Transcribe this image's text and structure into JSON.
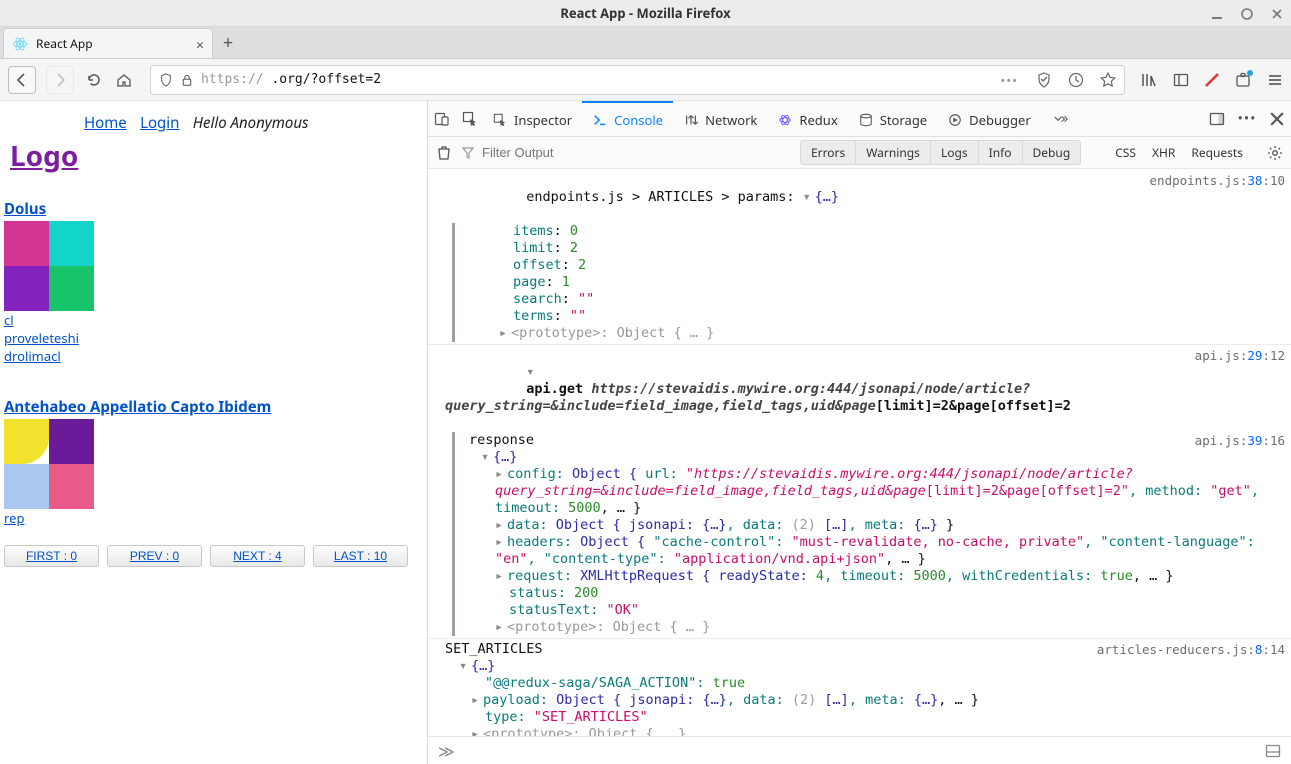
{
  "window": {
    "title": "React App - Mozilla Firefox"
  },
  "tab": {
    "label": "React App"
  },
  "url": {
    "scheme": "https",
    "host_visible": "://",
    "host_blur": "                     ",
    "path": ".org/?offset=2"
  },
  "nav": {
    "home": "Home",
    "login": "Login",
    "greeting": "Hello Anonymous"
  },
  "brand": {
    "logo": "Logo"
  },
  "articles": [
    {
      "title": "Dolus",
      "colors": [
        "#d23494",
        "#12d4c9",
        "#8323bd",
        "#18c56a"
      ],
      "tags": [
        "cl",
        "proveleteshi",
        "drolimacl"
      ]
    },
    {
      "title": "Antehabeo Appellatio Capto Ibidem",
      "colors": [
        "#f2e22e",
        "#6a1b9a",
        "#aac7ef",
        "#e85a87"
      ],
      "tags": [
        "rep"
      ]
    }
  ],
  "pager": {
    "first": "FIRST : 0",
    "prev": "PREV : 0",
    "next": "NEXT : 4",
    "last": "LAST : 10"
  },
  "devtools": {
    "tabs": [
      "Inspector",
      "Console",
      "Network",
      "Redux",
      "Storage",
      "Debugger"
    ],
    "active_tab": "Console",
    "filter_placeholder": "Filter Output",
    "levels": [
      "Errors",
      "Warnings",
      "Logs",
      "Info",
      "Debug"
    ],
    "cats": [
      "CSS",
      "XHR",
      "Requests"
    ],
    "sources": {
      "endpoints": "endpoints.js:38:10",
      "api_get": "api.js:29:12",
      "api_resp": "api.js:39:16",
      "reducers": "articles-reducers.js:8:14"
    }
  },
  "console": {
    "line1_prefix": "endpoints.js > ARTICLES > params: ",
    "params": {
      "items": "0",
      "limit": "2",
      "offset": "2",
      "page": "1",
      "search": "\"\"",
      "terms": "\"\"",
      "proto": "<prototype>: Object { … }"
    },
    "api_get_1": "api.get ",
    "api_get_url_a": "https://stevaidis.mywire.org:444/jsonapi/node/article?query_string=&include=field_image,field_tags,uid&page",
    "api_get_url_b": "[limit]=2&page[offset]=2",
    "response_label": "response",
    "config_1": "config: ",
    "config_obj": "Object { ",
    "config_url_key": "url: ",
    "config_url_a": "\"https://stevaidis.mywire.org:444/jsonapi/node/article?query_string=&include=field_image,field_tags,uid&page",
    "config_url_b": "[limit]=2&page[offset]=2\"",
    "config_method": ", method: ",
    "config_method_v": "\"get\"",
    "config_timeout": ", timeout: ",
    "config_timeout_v": "5000",
    "data_line_1": "data: ",
    "data_line_2": "Object { jsonapi: ",
    "data_line_jsn": "{…}",
    "data_line_3": ", data: ",
    "data_count": "(2)",
    "data_arr": "[…]",
    "data_meta": ", meta: ",
    "data_meta_v": "{…}",
    "headers_1": "headers: ",
    "headers_obj": "Object { ",
    "headers_cc": "\"cache-control\": ",
    "headers_cc_v": "\"must-revalidate, no-cache, private\"",
    "headers_cl": ", \"content-language\": ",
    "headers_cl_v": "\"en\"",
    "headers_ct": ", \"content-type\": ",
    "headers_ct_v": "\"application/vnd.api+json\"",
    "request_1": "request: ",
    "request_xhr": "XMLHttpRequest { readyState: ",
    "request_rs_v": "4",
    "request_to": ", timeout: ",
    "request_to_v": "5000",
    "request_wc": ", withCredentials: ",
    "request_wc_v": "true",
    "status_k": "status: ",
    "status_v": "200",
    "statusText_k": "statusText: ",
    "statusText_v": "\"OK\"",
    "proto_small": "<prototype>: Object { … }",
    "set_articles": "SET_ARTICLES",
    "saga_key": "\"@@redux-saga/SAGA_ACTION\": ",
    "saga_val": "true",
    "payload_1": "payload: ",
    "type_k": "type: ",
    "type_v": "\"SET_ARTICLES\""
  }
}
